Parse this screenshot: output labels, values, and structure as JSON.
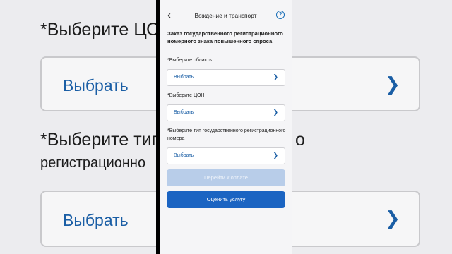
{
  "background": {
    "title_left": "*Выберите ЦОН",
    "select_left_top": "Выбрать",
    "line_type_1": "*Выберите тип",
    "line_type_2": "регистрационно",
    "select_left_bottom": "Выбрать",
    "right_fragment": "о"
  },
  "header": {
    "title": "Вождение и транспорт",
    "help_glyph": "?"
  },
  "form": {
    "heading": "Заказ государственного регистрационного номерного знака повышенного спроса",
    "fields": [
      {
        "label": "*Выберите область",
        "value": "Выбрать"
      },
      {
        "label": "*Выберите ЦОН",
        "value": "Выбрать"
      },
      {
        "label": "*Выберите тип государственного регистрационного номера",
        "value": "Выбрать"
      }
    ]
  },
  "buttons": {
    "pay": "Перейти к оплате",
    "rate": "Оценить услугу"
  },
  "colors": {
    "accent": "#1b64c2",
    "link": "#1a5ea5",
    "disabled": "#b8cde9"
  }
}
